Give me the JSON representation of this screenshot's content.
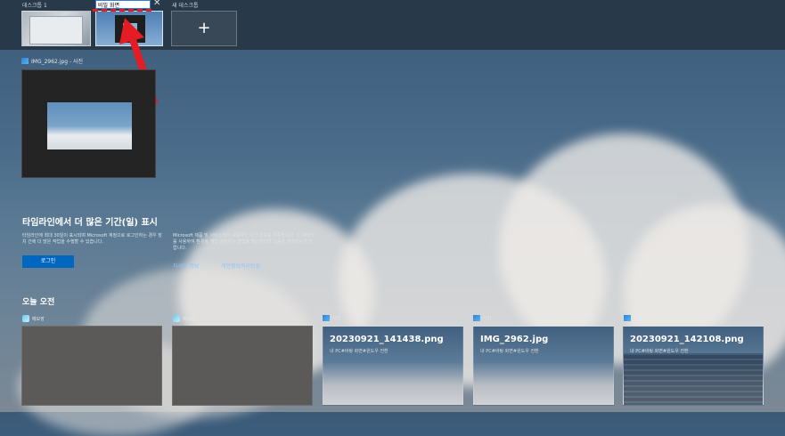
{
  "desktops": [
    {
      "label": "데스크톱 1"
    },
    {
      "label": "",
      "rename_value": "비밀 화면"
    },
    {
      "label": "새 데스크톱",
      "add_symbol": "+"
    }
  ],
  "close_symbol": "✕",
  "window": {
    "title": "IMG_2962.jpg - 사진"
  },
  "timeline": {
    "title": "타임라인에서 더 많은 기간(일) 표시",
    "description": "타임라인에 최대 30일이 표시되며 Microsoft 계정으로 로그인하는 경우 장치 간에 더 많은 작업을 수행할 수 있습니다.",
    "login_label": "로그인",
    "privacy_text": "Microsoft 제품 및 서비스에서 사용자의 개인 정보를 존중합니다. 이 데이터를 사용하여 환경을 개인 설정하는 방법을 확인하려면 다음을 참조하시기 바랍니다.",
    "link_more": "자세한 정보",
    "link_privacy": "개인정보처리방침"
  },
  "section_title": "오늘 오전",
  "activities": [
    {
      "app": "메모장"
    },
    {
      "app": "메모장"
    },
    {
      "app": "사진",
      "file": "20230921_141438.png",
      "sub": "내 PC#바탕 화면#윈도우 전환"
    },
    {
      "app": "사진",
      "file": "IMG_2962.jpg",
      "sub": "내 PC#바탕 화면#윈도우 전환"
    },
    {
      "app": "사진",
      "file": "20230921_142108.png",
      "sub": "내 PC#바탕 화면#윈도우 전환"
    }
  ],
  "colors": {
    "accent": "#0067c0",
    "highlight": "#e51c23"
  }
}
